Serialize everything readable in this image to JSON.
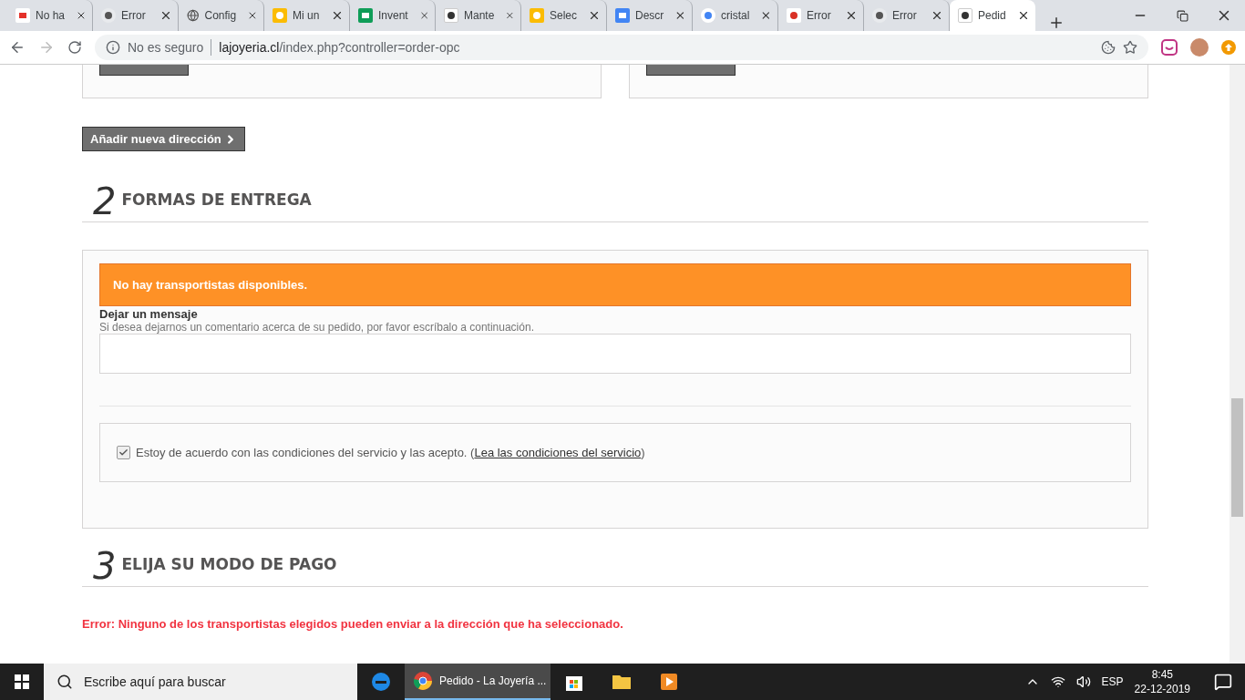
{
  "browser": {
    "tabs": [
      {
        "label": "No ha",
        "kind": "wish",
        "selected": false
      },
      {
        "label": "Error",
        "kind": "puffin",
        "selected": false
      },
      {
        "label": "Config",
        "kind": "globe",
        "selected": false
      },
      {
        "label": "Mi un",
        "kind": "drive",
        "selected": false
      },
      {
        "label": "Invent",
        "kind": "sheets",
        "selected": false
      },
      {
        "label": "Mante",
        "kind": "site",
        "selected": false
      },
      {
        "label": "Selec",
        "kind": "drive",
        "selected": false
      },
      {
        "label": "Descr",
        "kind": "docs",
        "selected": false
      },
      {
        "label": "cristal",
        "kind": "google",
        "selected": false
      },
      {
        "label": "Error",
        "kind": "gmail",
        "selected": false
      },
      {
        "label": "Error",
        "kind": "puffin",
        "selected": false
      },
      {
        "label": "Pedid",
        "kind": "site",
        "selected": true
      }
    ],
    "security": "No es seguro",
    "url_host": "lajoyeria.cl",
    "url_path": "/index.php?controller=order-opc"
  },
  "page": {
    "add_address_button": "Añadir nueva dirección",
    "sections": [
      {
        "number": "2",
        "title": "FORMAS DE ENTREGA"
      },
      {
        "number": "3",
        "title": "ELIJA SU MODO DE PAGO"
      }
    ],
    "alert": "No hay transportistas disponibles.",
    "message_label": "Dejar un mensaje",
    "message_hint": "Si desea dejarnos un comentario acerca de su pedido, por favor escríbalo a continuación.",
    "terms": {
      "text": "Estoy de acuerdo con las condiciones del servicio y las acepto. (",
      "link": "Lea las condiciones del servicio",
      "close": ")",
      "checked": true
    },
    "error": "Error: Ninguno de los transportistas elegidos pueden enviar a la dirección que ha seleccionado."
  },
  "taskbar": {
    "search_placeholder": "Escribe aquí para buscar",
    "active_app": "Pedido - La Joyería ...",
    "language": "ESP",
    "time": "8:45",
    "date": "22-12-2019"
  }
}
